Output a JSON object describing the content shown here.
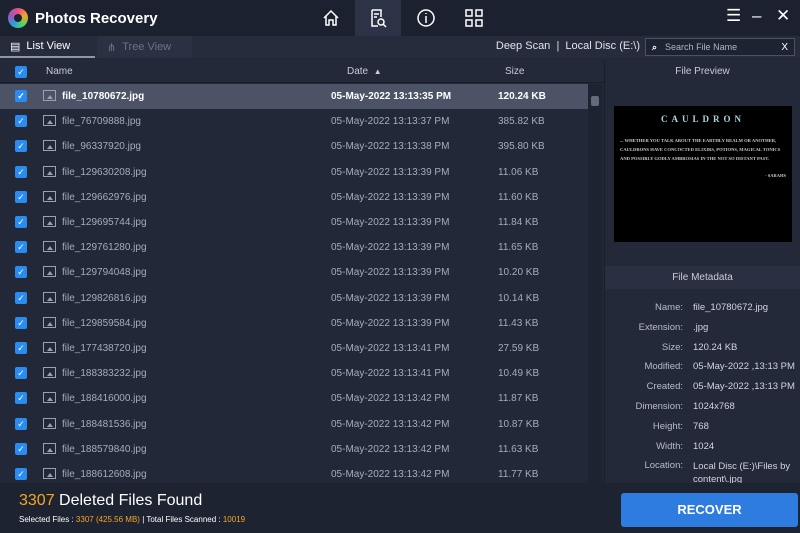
{
  "app": {
    "title": "Photos Recovery"
  },
  "nav": [
    "home-icon",
    "scan-results-icon",
    "info-icon",
    "grid-icon"
  ],
  "tabs": {
    "list": "List View",
    "tree": "Tree View"
  },
  "scan": {
    "mode": "Deep Scan",
    "separator": "|",
    "location": "Local Disc (E:\\)"
  },
  "search": {
    "placeholder": "Search File Name",
    "clear": "X"
  },
  "columns": {
    "name": "Name",
    "date": "Date",
    "sort": "▲",
    "size": "Size"
  },
  "files": [
    {
      "name": "file_10780672.jpg",
      "date": "05-May-2022 13:13:35 PM",
      "size": "120.24 KB"
    },
    {
      "name": "file_76709888.jpg",
      "date": "05-May-2022 13:13:37 PM",
      "size": "385.82 KB"
    },
    {
      "name": "file_96337920.jpg",
      "date": "05-May-2022 13:13:38 PM",
      "size": "395.80 KB"
    },
    {
      "name": "file_129630208.jpg",
      "date": "05-May-2022 13:13:39 PM",
      "size": "11.06 KB"
    },
    {
      "name": "file_129662976.jpg",
      "date": "05-May-2022 13:13:39 PM",
      "size": "11.60 KB"
    },
    {
      "name": "file_129695744.jpg",
      "date": "05-May-2022 13:13:39 PM",
      "size": "11.84 KB"
    },
    {
      "name": "file_129761280.jpg",
      "date": "05-May-2022 13:13:39 PM",
      "size": "11.65 KB"
    },
    {
      "name": "file_129794048.jpg",
      "date": "05-May-2022 13:13:39 PM",
      "size": "10.20 KB"
    },
    {
      "name": "file_129826816.jpg",
      "date": "05-May-2022 13:13:39 PM",
      "size": "10.14 KB"
    },
    {
      "name": "file_129859584.jpg",
      "date": "05-May-2022 13:13:39 PM",
      "size": "11.43 KB"
    },
    {
      "name": "file_177438720.jpg",
      "date": "05-May-2022 13:13:41 PM",
      "size": "27.59 KB"
    },
    {
      "name": "file_188383232.jpg",
      "date": "05-May-2022 13:13:41 PM",
      "size": "10.49 KB"
    },
    {
      "name": "file_188416000.jpg",
      "date": "05-May-2022 13:13:42 PM",
      "size": "11.87 KB"
    },
    {
      "name": "file_188481536.jpg",
      "date": "05-May-2022 13:13:42 PM",
      "size": "10.87 KB"
    },
    {
      "name": "file_188579840.jpg",
      "date": "05-May-2022 13:13:42 PM",
      "size": "11.63 KB"
    },
    {
      "name": "file_188612608.jpg",
      "date": "05-May-2022 13:13:42 PM",
      "size": "11.77 KB"
    }
  ],
  "preview": {
    "header": "File Preview",
    "title": "CAULDRON",
    "body": "... WHETHER YOU TALK ABOUT THE EARTHLY REALM OR ANOTHER, CAULDRONS HAVE CONCOCTED ELIXIRS, POTIONS, MAGICAL TONICS AND POSSIBLY GODLY AMBROSIAS IN THE NOT SO DISTANT PAST.",
    "author": "- SARAHS"
  },
  "metadata": {
    "header": "File Metadata",
    "fields": [
      {
        "k": "Name:",
        "v": "file_10780672.jpg"
      },
      {
        "k": "Extension:",
        "v": ".jpg"
      },
      {
        "k": "Size:",
        "v": "120.24 KB"
      },
      {
        "k": "Modified:",
        "v": "05-May-2022 ,13:13 PM"
      },
      {
        "k": "Created:",
        "v": "05-May-2022 ,13:13 PM"
      },
      {
        "k": "Dimension:",
        "v": "1024x768"
      },
      {
        "k": "Height:",
        "v": "768"
      },
      {
        "k": "Width:",
        "v": "1024"
      },
      {
        "k": "Location:",
        "v": "Local Disc (E:)\\Files by content\\.jpg"
      }
    ]
  },
  "footer": {
    "count": "3307",
    "found_label": " Deleted Files Found",
    "selected_label": "Selected Files : ",
    "selected_value": "3307 (425.56 MB)",
    "total_label": " | Total Files Scanned : ",
    "total_value": "10019",
    "recover": "RECOVER"
  },
  "colors": {
    "accent": "#2f7ce0",
    "highlight": "#f5a623"
  }
}
